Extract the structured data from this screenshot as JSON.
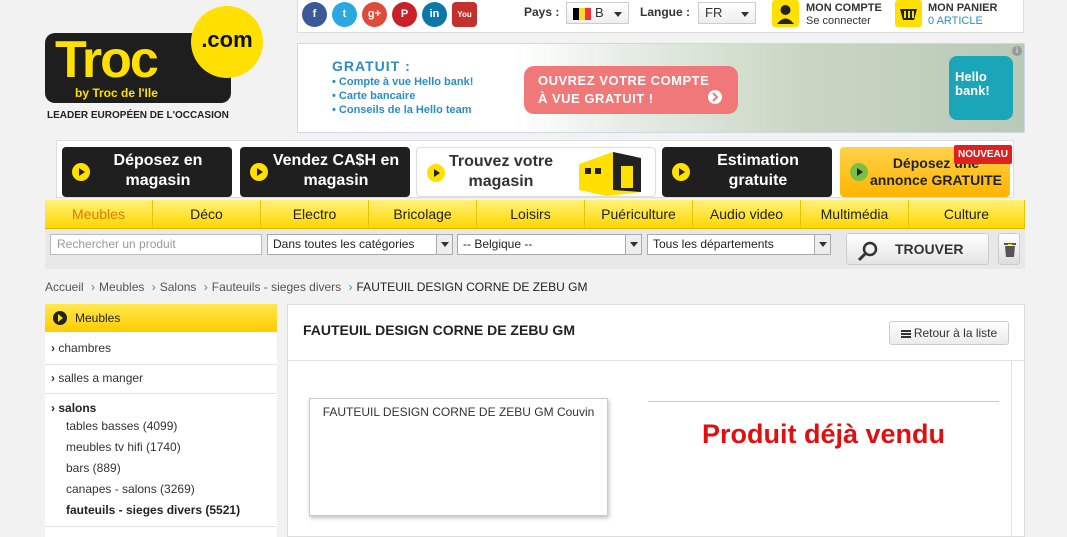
{
  "logo": {
    "brand": "Troc",
    "domain": ".com",
    "byline": "by Troc de l'Ile",
    "tagline": "LEADER EUROPÉEN DE L'OCCASION"
  },
  "social": [
    {
      "name": "facebook-icon",
      "glyph": "f",
      "color": "#3b5998"
    },
    {
      "name": "twitter-icon",
      "glyph": "t",
      "color": "#2aa9e0"
    },
    {
      "name": "google-plus-icon",
      "glyph": "g+",
      "color": "#dd4b39"
    },
    {
      "name": "pinterest-icon",
      "glyph": "P",
      "color": "#cb2027"
    },
    {
      "name": "linkedin-icon",
      "glyph": "in",
      "color": "#0e76a8"
    },
    {
      "name": "youtube-icon",
      "glyph": "You",
      "color": "#c4302b"
    }
  ],
  "topbar": {
    "pays_label": "Pays :",
    "pays_value": "B",
    "langue_label": "Langue :",
    "langue_value": "FR",
    "account_title": "MON COMPTE",
    "account_sub": "Se connecter",
    "cart_title": "MON PANIER",
    "cart_sub": "0 ARTICLE"
  },
  "banner": {
    "title": "GRATUIT :",
    "items": [
      "• Compte à vue Hello bank!",
      "• Carte bancaire",
      "• Conseils de la Hello team"
    ],
    "cta_line1": "OUVREZ VOTRE COMPTE",
    "cta_line2": "À VUE GRATUIT !",
    "bank_line1": "Hello",
    "bank_line2": "bank!"
  },
  "actions": [
    {
      "line1": "Déposez en",
      "line2": "magasin"
    },
    {
      "line1": "Vendez CA$H en",
      "line2": "magasin"
    },
    {
      "line1": "Trouvez votre",
      "line2": "magasin"
    },
    {
      "line1": "Estimation",
      "line2": "gratuite"
    },
    {
      "line1": "Déposez une",
      "line2": "annonce GRATUITE",
      "badge": "NOUVEAU"
    }
  ],
  "nav": [
    "Meubles",
    "Déco",
    "Electro",
    "Bricolage",
    "Loisirs",
    "Puériculture",
    "Audio video",
    "Multimédia",
    "Culture"
  ],
  "search": {
    "placeholder": "Rechercher un produit",
    "categories": "Dans toutes les catégories",
    "country": "-- Belgique --",
    "departments": "Tous les départements",
    "button": "TROUVER"
  },
  "breadcrumb": [
    "Accueil",
    "Meubles",
    "Salons",
    "Fauteuils - sieges divers",
    "FAUTEUIL DESIGN CORNE  DE ZEBU GM"
  ],
  "sidebar": {
    "header": "Meubles",
    "cat1": "chambres",
    "cat2": "salles a manger",
    "cat3": "salons",
    "subs": [
      "tables basses (4099)",
      "meubles tv hifi (1740)",
      "bars (889)",
      "canapes - salons (3269)",
      "fauteuils - sieges divers (5521)"
    ]
  },
  "product": {
    "title": "FAUTEUIL DESIGN CORNE  DE ZEBU GM",
    "back": "Retour à la liste",
    "card_caption": "FAUTEUIL DESIGN CORNE  DE ZEBU GM Couvin",
    "status": "Produit déjà vendu"
  }
}
